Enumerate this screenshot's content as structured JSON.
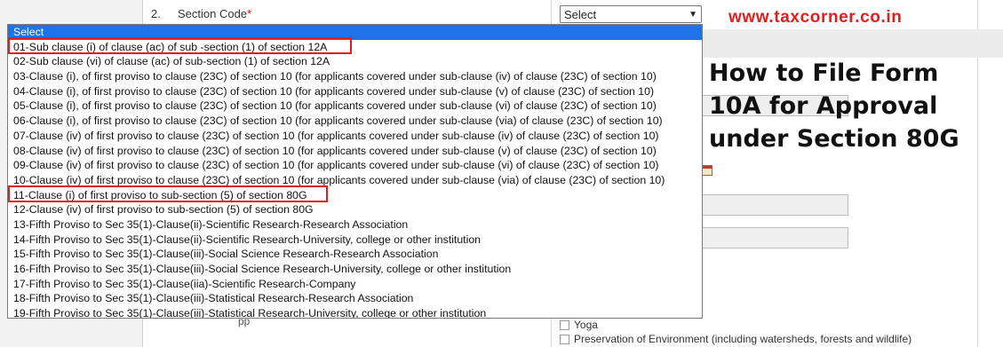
{
  "watermark": "www.taxcorner.co.in",
  "heading": {
    "line1": "How to File Form",
    "line2": "10A for Approval",
    "line3": "under Section 80G"
  },
  "form": {
    "row_number": "2.",
    "section_code_label": "Section Code",
    "required_mark": "*",
    "section_select_value": "Select",
    "objects": [
      "Yoga",
      "Preservation of Environment (including watersheds, forests and wildlife)"
    ],
    "partial_text": "pp"
  },
  "dropdown": {
    "options": [
      "Select",
      "01-Sub clause (i) of clause (ac) of sub -section (1) of section 12A",
      "02-Sub clause (vi) of clause (ac) of sub-section (1) of section 12A",
      "03-Clause (i), of first proviso to clause (23C) of section 10 (for applicants covered under sub-clause (iv) of clause (23C) of section 10)",
      "04-Clause (i), of first proviso to clause (23C) of section 10 (for applicants covered under sub-clause (v) of clause (23C) of section 10)",
      "05-Clause (i), of first proviso to clause (23C) of section 10 (for applicants covered under sub-clause (vi) of clause (23C) of section 10)",
      "06-Clause (i), of first proviso to clause (23C) of section 10 (for applicants covered under sub-clause (via) of clause (23C) of section 10)",
      "07-Clause (iv) of first proviso to clause (23C) of section 10 (for applicants covered under sub-clause (iv) of clause (23C) of section 10)",
      "08-Clause (iv) of first proviso to clause (23C) of section 10 (for applicants covered under sub-clause (v) of clause (23C) of section 10)",
      "09-Clause (iv) of first proviso to clause (23C) of section 10 (for applicants covered under sub-clause (vi) of clause (23C) of section 10)",
      "10-Clause (iv) of first proviso to clause (23C) of section 10 (for applicants covered under sub-clause (via) of clause (23C) of section 10)",
      "11-Clause (i) of first proviso to sub-section (5) of section 80G",
      "12-Clause (iv) of first proviso to sub-section (5) of section 80G",
      "13-Fifth Proviso to Sec 35(1)-Clause(ii)-Scientific Research-Research Association",
      "14-Fifth Proviso to Sec 35(1)-Clause(ii)-Scientific Research-University, college or other institution",
      "15-Fifth Proviso to Sec 35(1)-Clause(iii)-Social Science Research-Research Association",
      "16-Fifth Proviso to Sec 35(1)-Clause(iii)-Social Science Research-University, college or other institution",
      "17-Fifth Proviso to Sec 35(1)-Clause(iia)-Scientific Research-Company",
      "18-Fifth Proviso to Sec 35(1)-Clause(iii)-Statistical Research-Research Association",
      "19-Fifth Proviso to Sec 35(1)-Clause(iii)-Statistical Research-University, college or other institution"
    ]
  },
  "colors": {
    "selected_option_bg": "#1e73e8",
    "highlight_box": "#e21d1d",
    "watermark": "#e21d1d"
  }
}
